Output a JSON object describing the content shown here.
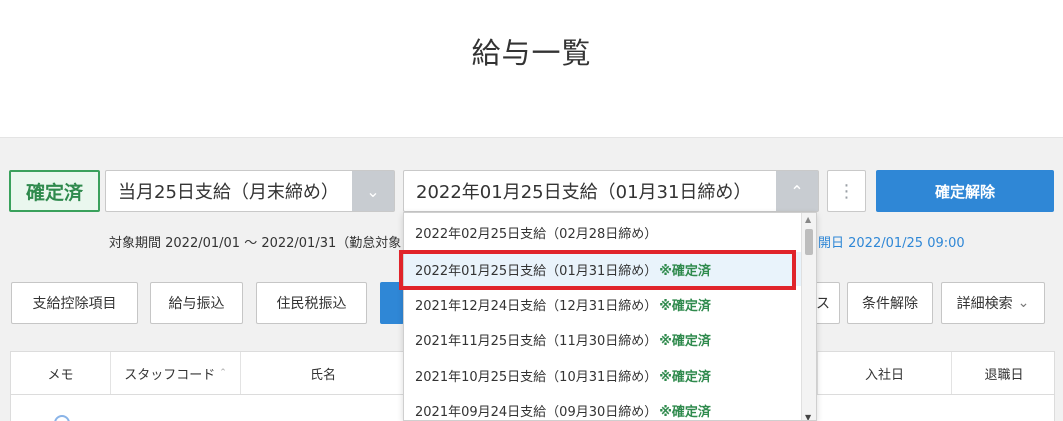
{
  "page": {
    "title": "給与一覧"
  },
  "toolbar": {
    "status_badge": "確定済",
    "schedule_select": {
      "value": "当月25日支給（月末締め）"
    },
    "period_select": {
      "value": "2022年01月25日支給（01月31日締め）"
    },
    "unconfirm_label": "確定解除",
    "period_text": "対象期間 2022/01/01 〜 2022/01/31（勤怠対象",
    "open_text": "開日 2022/01/25 09:00"
  },
  "actions": {
    "deductions": "支給控除項目",
    "transfer": "給与振込",
    "resident_tax": "住民税振込",
    "partial_su": "ス",
    "clear_filter": "条件解除",
    "detail_search": "詳細検索"
  },
  "table": {
    "headers": {
      "memo": "メモ",
      "staff_code": "スタッフコード",
      "name": "氏名",
      "hire_date": "入社日",
      "retire_date": "退職日"
    }
  },
  "dropdown": {
    "items": [
      {
        "label": "2022年02月25日支給（02月28日締め）",
        "status": ""
      },
      {
        "label": "2022年01月25日支給（01月31日締め）",
        "status": "※確定済"
      },
      {
        "label": "2021年12月24日支給（12月31日締め）",
        "status": "※確定済"
      },
      {
        "label": "2021年11月25日支給（11月30日締め）",
        "status": "※確定済"
      },
      {
        "label": "2021年10月25日支給（10月31日締め）",
        "status": "※確定済"
      },
      {
        "label": "2021年09月24日支給（09月30日締め）",
        "status": "※確定済"
      }
    ],
    "selected_index": 1
  },
  "colors": {
    "accent_blue": "#2f87d6",
    "confirmed_green": "#2f8a4d",
    "highlight_red": "#e0242b"
  },
  "icons": {
    "select_arrow": "chevron-down-icon",
    "select_arrow_open": "chevron-up-icon",
    "kebab": "more-vertical-icon",
    "sort": "sort-caret-icon"
  }
}
